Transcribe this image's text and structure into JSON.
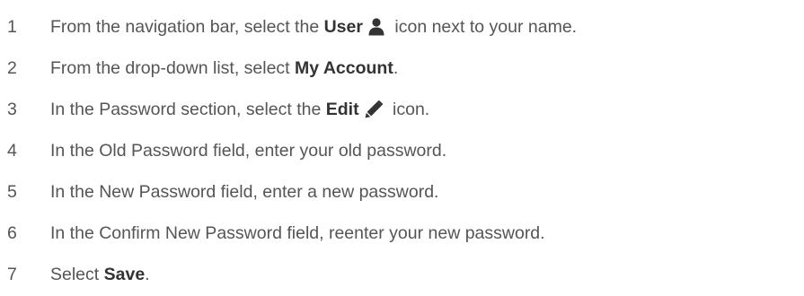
{
  "steps": [
    {
      "number": "1",
      "before": "From the navigation bar, select the ",
      "bold": "User",
      "after": " icon next to your name."
    },
    {
      "number": "2",
      "before": "From the drop-down list, select ",
      "bold": "My Account",
      "after": "."
    },
    {
      "number": "3",
      "before": "In the Password section, select the ",
      "bold": "Edit",
      "after": " icon."
    },
    {
      "number": "4",
      "text": "In the Old Password field, enter your old password."
    },
    {
      "number": "5",
      "text": "In the New Password field, enter a new password."
    },
    {
      "number": "6",
      "text": "In the Confirm New Password field, reenter your new password."
    },
    {
      "number": "7",
      "before": "Select ",
      "bold": "Save",
      "after": "."
    }
  ],
  "icons": {
    "step1": "user-icon",
    "step3": "pencil-icon"
  },
  "colors": {
    "text": "#555555",
    "bold_text": "#333333",
    "icon": "#333333"
  }
}
